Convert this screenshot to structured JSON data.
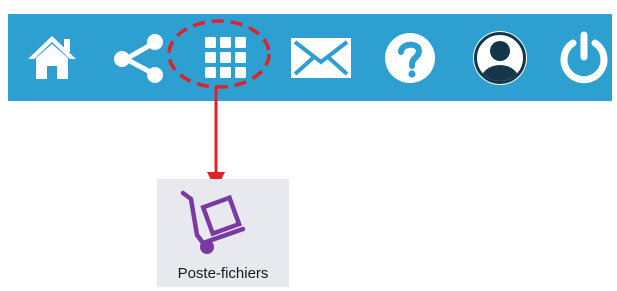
{
  "toolbar": {
    "background_color": "#2d9fd0",
    "icon_color": "#ffffff",
    "buttons": [
      {
        "icon": "home-icon"
      },
      {
        "icon": "share-icon"
      },
      {
        "icon": "apps-grid-icon"
      },
      {
        "icon": "mail-icon"
      },
      {
        "icon": "help-icon"
      },
      {
        "icon": "user-account-icon"
      },
      {
        "icon": "power-icon"
      }
    ]
  },
  "annotation": {
    "color": "#e0202a",
    "highlighted": "apps-grid-icon"
  },
  "apps": [
    {
      "label": "Poste-fichiers",
      "icon": "hand-truck-icon",
      "icon_color": "#7b3aa2",
      "tile_color": "#e8e9ee"
    }
  ]
}
